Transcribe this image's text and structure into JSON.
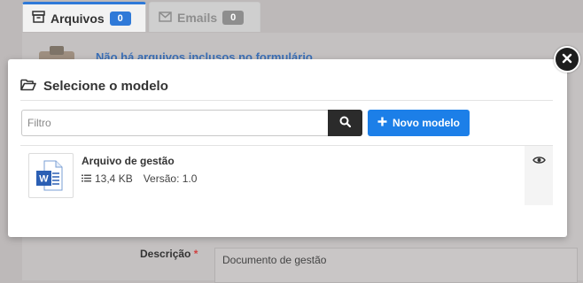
{
  "background": {
    "tabs": [
      {
        "label": "Arquivos",
        "count": "0"
      },
      {
        "label": "Emails",
        "count": "0"
      }
    ],
    "notice": "Não há arquivos inclusos no formulário",
    "description_label": "Descrição",
    "required_mark": "*",
    "description_value": "Documento de gestão"
  },
  "modal": {
    "title": "Selecione o modelo",
    "filter_placeholder": "Filtro",
    "new_button_label": "Novo modelo",
    "documents": [
      {
        "name": "Arquivo de gestão",
        "size": "13,4 KB",
        "version": "Versão: 1.0",
        "icon": "word-document-icon"
      }
    ]
  },
  "icons": {
    "archive": "archive-icon",
    "envelope": "envelope-icon",
    "folder_open": "folder-open-icon",
    "search": "search-icon",
    "plus": "plus-icon",
    "list": "list-icon",
    "eye": "eye-icon",
    "close": "close-icon"
  },
  "colors": {
    "accent": "#1c7fe8",
    "tab_accent": "#2f79d8",
    "search_button": "#2b2b2b",
    "word_blue": "#2b5fb4"
  }
}
